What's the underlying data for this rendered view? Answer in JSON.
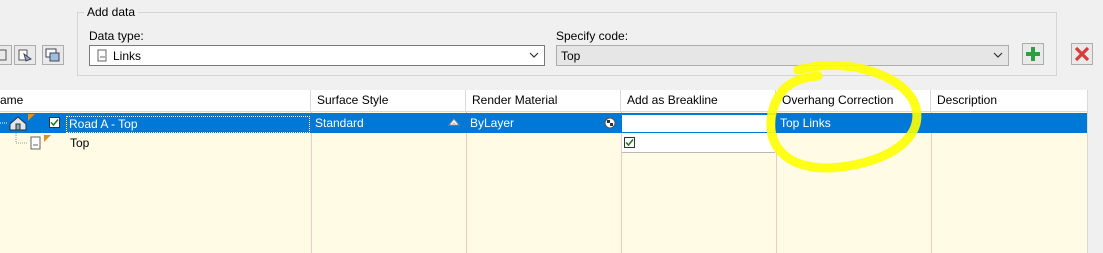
{
  "add_data": {
    "group_title": "Add data",
    "data_type_label": "Data type:",
    "data_type_value": "Links",
    "specify_code_label": "Specify code:",
    "specify_code_value": "Top"
  },
  "grid": {
    "columns": [
      "ame",
      "Surface Style",
      "Render Material",
      "Add as Breakline",
      "Overhang Correction",
      "Description"
    ],
    "rows": [
      {
        "name": "Road A - Top",
        "surface_style": "Standard",
        "render_material": "ByLayer",
        "add_as_breakline": "",
        "overhang_correction": "Top Links",
        "description": "",
        "selected": true
      },
      {
        "name": "Top",
        "surface_style": "",
        "render_material": "",
        "add_as_breakline": "checked",
        "overhang_correction": "",
        "description": "",
        "selected": false
      }
    ]
  },
  "colors": {
    "selection": "#0078d7",
    "grid_background": "#fffbe5",
    "annotation_highlight": "#ffff00",
    "add_icon": "#2e9e3e",
    "remove_icon": "#d83b3b"
  },
  "icons": [
    "tool-icon-1",
    "tool-icon-2",
    "tool-icon-3",
    "links-icon",
    "chevron-down-icon",
    "add-icon",
    "remove-icon",
    "tree-expander-icon",
    "surface-icon",
    "checkbox-icon",
    "link-icon",
    "ellipsis-button-icon",
    "material-button-icon"
  ]
}
